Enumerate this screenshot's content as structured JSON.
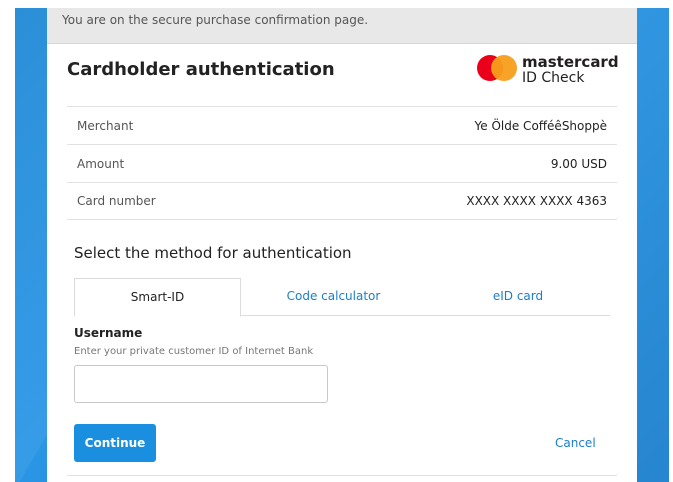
{
  "topbar": {
    "message": "You are on the secure purchase confirmation page."
  },
  "header": {
    "title": "Cardholder authentication",
    "logo": {
      "brand": "mastercard",
      "product": "ID Check",
      "colors": {
        "red": "#eb001b",
        "orange": "#f79e1b"
      }
    }
  },
  "details": [
    {
      "label": "Merchant",
      "value": "Ye Ölde CofféêShoppè"
    },
    {
      "label": "Amount",
      "value": "9.00 USD"
    },
    {
      "label": "Card number",
      "value": "XXXX XXXX XXXX 4363"
    }
  ],
  "method": {
    "title": "Select the method for authentication",
    "tabs": [
      {
        "label": "Smart-ID",
        "active": true
      },
      {
        "label": "Code calculator",
        "active": false
      },
      {
        "label": "eID card",
        "active": false
      }
    ]
  },
  "form": {
    "username_label": "Username",
    "username_hint": "Enter your private customer ID of Internet Bank",
    "username_value": "",
    "continue_label": "Continue",
    "cancel_label": "Cancel"
  },
  "colors": {
    "accent": "#1a8fdf",
    "link": "#1a7fc7",
    "background_blue": "#1e88d6"
  }
}
